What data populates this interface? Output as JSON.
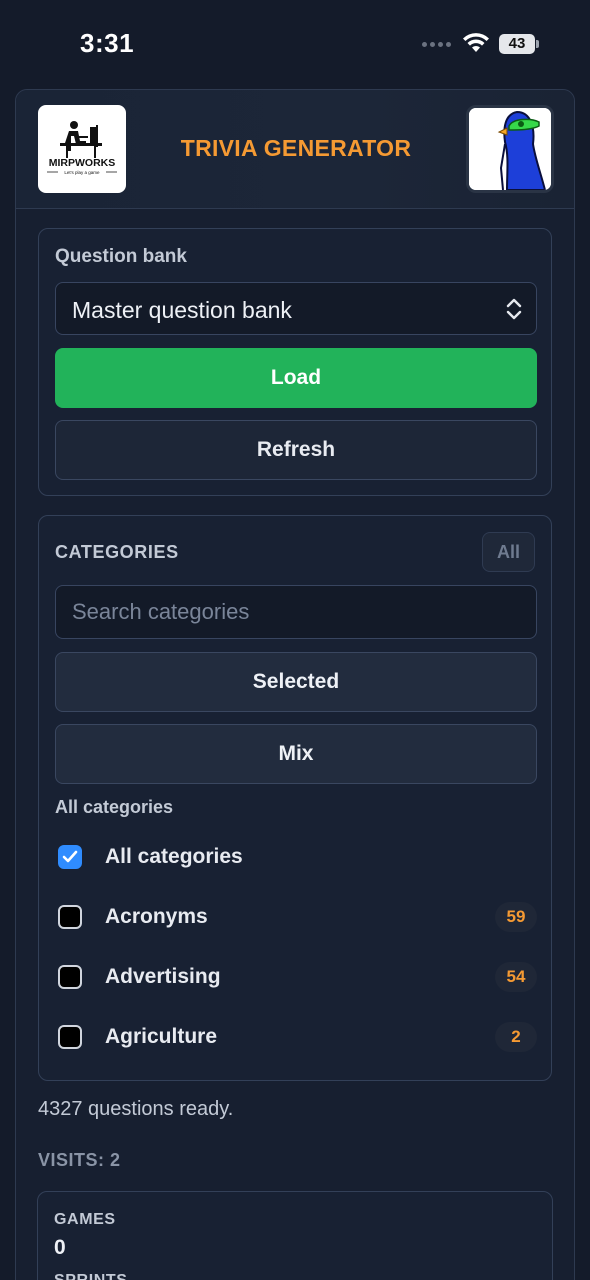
{
  "status_bar": {
    "time": "3:31",
    "battery": "43"
  },
  "header": {
    "title": "TRIVIA GENERATOR",
    "left_logo": {
      "icon": "mirpworks-logo",
      "text": "MIRPWORKS",
      "tagline": "Let's play a game"
    },
    "right_logo": {
      "icon": "penguin-avatar"
    }
  },
  "bank": {
    "label": "Question bank",
    "selected": "Master question bank",
    "load_label": "Load",
    "refresh_label": "Refresh"
  },
  "categories": {
    "heading": "CATEGORIES",
    "all_chip": "All",
    "search_placeholder": "Search categories",
    "selected_label": "Selected",
    "mix_label": "Mix",
    "list_heading": "All categories",
    "items": [
      {
        "label": "All categories",
        "checked": true,
        "count": ""
      },
      {
        "label": "Acronyms",
        "checked": false,
        "count": "59"
      },
      {
        "label": "Advertising",
        "checked": false,
        "count": "54"
      },
      {
        "label": "Agriculture",
        "checked": false,
        "count": "2"
      }
    ]
  },
  "status": {
    "ready": "4327 questions ready.",
    "visits": "VISITS: 2"
  },
  "stats": {
    "games_label": "GAMES",
    "games_value": "0",
    "sprints_label": "SPRINTS"
  },
  "colors": {
    "accent_orange": "#f59a33",
    "load_green": "#22b35a",
    "check_blue": "#2f8cff",
    "background": "#141b2a"
  }
}
